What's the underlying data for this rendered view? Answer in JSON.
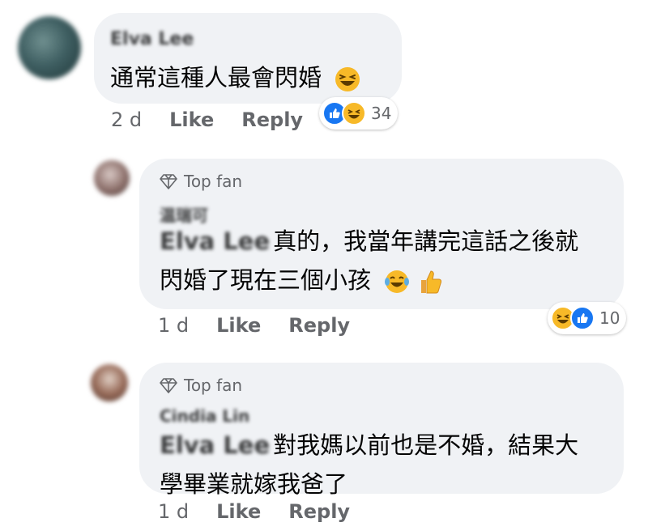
{
  "comment1": {
    "author_blurred": "Elva Lee",
    "text": "通常這種人最會閃婚",
    "time": "2 d",
    "like_label": "Like",
    "reply_label": "Reply",
    "reaction_count": "34"
  },
  "reply1": {
    "badge": "Top fan",
    "author_blurred": "温瑞可",
    "mention_blurred": "Elva Lee",
    "text_line1": "真的，我當年講完這話之後就",
    "text_line2": "閃婚了現在三個小孩",
    "time": "1 d",
    "like_label": "Like",
    "reply_label": "Reply",
    "reaction_count": "10"
  },
  "reply2": {
    "badge": "Top fan",
    "author_blurred": "Cindia Lin",
    "mention_blurred": "Elva Lee",
    "text_line1": "對我媽以前也是不婚，結果大",
    "text_line2": "學畢業就嫁我爸了",
    "time": "1 d",
    "like_label": "Like",
    "reply_label": "Reply"
  },
  "colors": {
    "bubble": "#f0f2f5",
    "secondary_text": "#65676b",
    "like_blue": "#1877f2",
    "haha_yellow": "#f7b928"
  },
  "icons": [
    "diamond-icon",
    "like-reaction-icon",
    "haha-reaction-icon",
    "laughing-emoji",
    "tears-of-joy-emoji",
    "thumbs-up-emoji"
  ]
}
